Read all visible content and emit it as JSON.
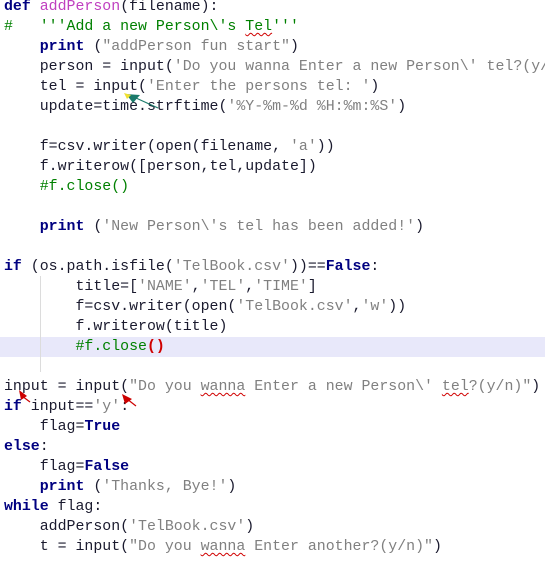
{
  "editor": {
    "highlight_line": 18,
    "lines": [
      [
        {
          "t": "def",
          "c": "k"
        },
        {
          "t": " ",
          "c": "n"
        },
        {
          "t": "addPerson",
          "c": "f"
        },
        {
          "t": "(filename):",
          "c": "n"
        }
      ],
      [
        {
          "t": "#   '''Add a new Person\\'s ",
          "c": "c"
        },
        {
          "t": "Tel",
          "c": "c",
          "u": true
        },
        {
          "t": "'''",
          "c": "c"
        }
      ],
      [
        {
          "t": "    ",
          "c": "n"
        },
        {
          "t": "print",
          "c": "k"
        },
        {
          "t": " (",
          "c": "n"
        },
        {
          "t": "\"addPerson fun start\"",
          "c": "s"
        },
        {
          "t": ")",
          "c": "n"
        }
      ],
      [
        {
          "t": "    person = input(",
          "c": "n"
        },
        {
          "t": "'Do you wanna Enter a new Person\\' tel?(y/n)')",
          "c": "s"
        }
      ],
      [
        {
          "t": "    tel = input(",
          "c": "n"
        },
        {
          "t": "'Enter the persons tel: '",
          "c": "s"
        },
        {
          "t": ")",
          "c": "n"
        }
      ],
      [
        {
          "t": "    update=time.strftime(",
          "c": "n"
        },
        {
          "t": "'%Y-%m-%d %H:%m:%S'",
          "c": "s"
        },
        {
          "t": ")",
          "c": "n"
        }
      ],
      [],
      [
        {
          "t": "    f=csv.writer(open(filename, ",
          "c": "n"
        },
        {
          "t": "'a'",
          "c": "s"
        },
        {
          "t": "))",
          "c": "n"
        }
      ],
      [
        {
          "t": "    f.writerow([person,tel,update])",
          "c": "n"
        }
      ],
      [
        {
          "t": "    #f.close()",
          "c": "c"
        }
      ],
      [],
      [
        {
          "t": "    ",
          "c": "n"
        },
        {
          "t": "print",
          "c": "k"
        },
        {
          "t": " (",
          "c": "n"
        },
        {
          "t": "'New Person\\'s tel has been added!'",
          "c": "s"
        },
        {
          "t": ")",
          "c": "n"
        }
      ],
      [],
      [
        {
          "t": "if",
          "c": "k"
        },
        {
          "t": " (os.path.isfile(",
          "c": "n"
        },
        {
          "t": "'TelBook.csv'",
          "c": "s"
        },
        {
          "t": "))==",
          "c": "n"
        },
        {
          "t": "False",
          "c": "k"
        },
        {
          "t": ":",
          "c": "n"
        }
      ],
      [
        {
          "t": "        title=[",
          "c": "n"
        },
        {
          "t": "'NAME'",
          "c": "s"
        },
        {
          "t": ",",
          "c": "n"
        },
        {
          "t": "'TEL'",
          "c": "s"
        },
        {
          "t": ",",
          "c": "n"
        },
        {
          "t": "'TIME'",
          "c": "s"
        },
        {
          "t": "]",
          "c": "n"
        }
      ],
      [
        {
          "t": "        f=csv.writer(open(",
          "c": "n"
        },
        {
          "t": "'TelBook.csv'",
          "c": "s"
        },
        {
          "t": ",",
          "c": "n"
        },
        {
          "t": "'w'",
          "c": "s"
        },
        {
          "t": "))",
          "c": "n"
        }
      ],
      [
        {
          "t": "        f.writerow(title)",
          "c": "n"
        }
      ],
      [
        {
          "t": "        #f.close",
          "c": "c"
        },
        {
          "t": "()",
          "c": "r"
        }
      ],
      [],
      [
        {
          "t": "input = input(",
          "c": "n"
        },
        {
          "t": "\"Do you ",
          "c": "s"
        },
        {
          "t": "wanna",
          "c": "s",
          "u": true
        },
        {
          "t": " Enter a new Person\\' ",
          "c": "s"
        },
        {
          "t": "tel",
          "c": "s",
          "u": true
        },
        {
          "t": "?(y/n)\"",
          "c": "s"
        },
        {
          "t": ")",
          "c": "n"
        }
      ],
      [
        {
          "t": "if",
          "c": "k"
        },
        {
          "t": " input==",
          "c": "n"
        },
        {
          "t": "'y'",
          "c": "s"
        },
        {
          "t": ":",
          "c": "n"
        }
      ],
      [
        {
          "t": "    flag=",
          "c": "n"
        },
        {
          "t": "True",
          "c": "k"
        }
      ],
      [
        {
          "t": "else",
          "c": "k"
        },
        {
          "t": ":",
          "c": "n"
        }
      ],
      [
        {
          "t": "    flag=",
          "c": "n"
        },
        {
          "t": "False",
          "c": "k"
        }
      ],
      [
        {
          "t": "    ",
          "c": "n"
        },
        {
          "t": "print",
          "c": "k"
        },
        {
          "t": " (",
          "c": "n"
        },
        {
          "t": "'Thanks, Bye!'",
          "c": "s"
        },
        {
          "t": ")",
          "c": "n"
        }
      ],
      [
        {
          "t": "while",
          "c": "k"
        },
        {
          "t": " flag:",
          "c": "n"
        }
      ],
      [
        {
          "t": "    addPerson(",
          "c": "n"
        },
        {
          "t": "'TelBook.csv'",
          "c": "s"
        },
        {
          "t": ")",
          "c": "n"
        }
      ],
      [
        {
          "t": "    t = input(",
          "c": "n"
        },
        {
          "t": "\"Do you ",
          "c": "s"
        },
        {
          "t": "wanna",
          "c": "s",
          "u": true
        },
        {
          "t": " Enter another?(y/n)\"",
          "c": "s"
        },
        {
          "t": ")",
          "c": "n"
        }
      ]
    ]
  },
  "colors": {
    "keyword": "#000080",
    "function": "#c040c0",
    "string": "#808080",
    "comment": "#008000",
    "highlight": "#e8e8fa",
    "arrow_red": "#cc0000",
    "arrow_green": "#1a7a6a"
  },
  "annotations": [
    "green-arrow-pointer",
    "red-arrow-pointer",
    "red-arrow-pointer"
  ]
}
